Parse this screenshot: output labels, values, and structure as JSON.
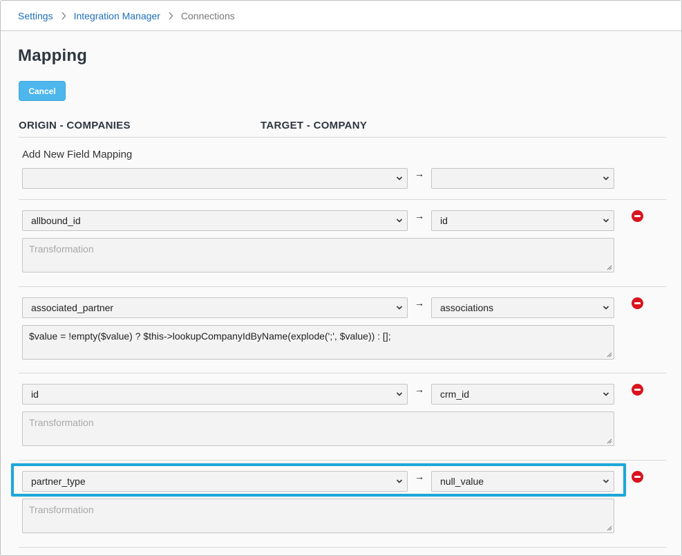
{
  "breadcrumb": {
    "items": [
      {
        "label": "Settings"
      },
      {
        "label": "Integration Manager"
      },
      {
        "label": "Connections"
      }
    ]
  },
  "page": {
    "title": "Mapping",
    "cancel_label": "Cancel"
  },
  "columns": {
    "origin": "ORIGIN - COMPANIES",
    "target": "TARGET - COMPANY"
  },
  "add_mapping": {
    "label": "Add New Field Mapping",
    "origin_value": "",
    "target_value": "",
    "arrow": "→"
  },
  "mappings": [
    {
      "origin": "allbound_id",
      "target": "id",
      "transformation": "",
      "placeholder": "Transformation",
      "arrow": "→"
    },
    {
      "origin": "associated_partner",
      "target": "associations",
      "transformation": "$value = !empty($value) ? $this->lookupCompanyIdByName(explode(';', $value)) : [];",
      "placeholder": "Transformation",
      "arrow": "→"
    },
    {
      "origin": "id",
      "target": "crm_id",
      "transformation": "",
      "placeholder": "Transformation",
      "arrow": "→"
    },
    {
      "origin": "partner_type",
      "target": "null_value",
      "transformation": "",
      "placeholder": "Transformation",
      "arrow": "→"
    }
  ],
  "colors": {
    "link": "#1f6fb8",
    "button": "#4db6ec",
    "remove": "#d9141e",
    "highlight": "#1da8d8"
  },
  "icons": {
    "breadcrumb_separator": "chevron-right-icon",
    "select_caret": "chevron-down-icon",
    "remove": "remove-circle-icon",
    "resize": "resize-grip-icon"
  }
}
